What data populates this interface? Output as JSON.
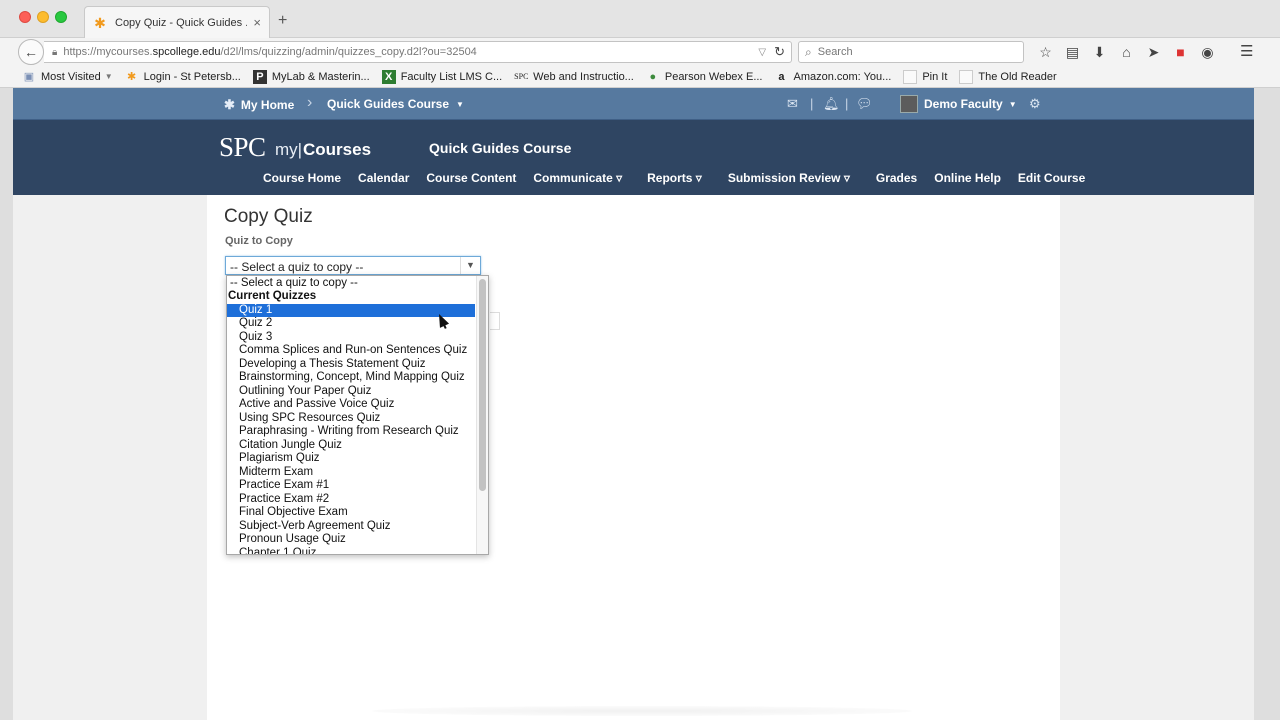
{
  "browser": {
    "tab_title": "Copy Quiz - Quick Guides ...",
    "tab_close": "×",
    "new_tab": "+",
    "url_prefix": "https://mycourses.",
    "url_domain": "spcollege.edu",
    "url_path": "/d2l/lms/quizzing/admin/quizzes_copy.d2l?ou=32504",
    "search_placeholder": "Search",
    "bookmarks": [
      {
        "label": "Most Visited",
        "icon": "folder-icon",
        "color": "#7a8fb5"
      },
      {
        "label": "Login - St Petersb...",
        "icon": "spc-icon",
        "color": "#f19a1e"
      },
      {
        "label": "MyLab & Masterin...",
        "icon": "pearson-p-icon",
        "color": "#333333"
      },
      {
        "label": "Faculty List LMS C...",
        "icon": "excel-icon",
        "color": "#2e7d32"
      },
      {
        "label": "Web and Instructio...",
        "icon": "spc-text-icon",
        "color": "#333333"
      },
      {
        "label": "Pearson Webex E...",
        "icon": "globe-icon",
        "color": "#3d8b3d"
      },
      {
        "label": "Amazon.com: You...",
        "icon": "amazon-icon",
        "color": "#111111"
      },
      {
        "label": "Pin It",
        "icon": "page-icon",
        "color": "#bbbbbb"
      },
      {
        "label": "The Old Reader",
        "icon": "page-icon",
        "color": "#bbbbbb"
      }
    ]
  },
  "minibar": {
    "home_label": "My Home",
    "course_label": "Quick Guides Course",
    "user_label": "Demo Faculty"
  },
  "navbar": {
    "logo_spc": "SPC",
    "logo_my": "my|",
    "logo_courses": "Courses",
    "course_title": "Quick Guides Course",
    "links": [
      "Course Home",
      "Calendar",
      "Course Content",
      "Communicate ▿",
      "Reports ▿",
      "Submission Review ▿",
      "Grades",
      "Online Help",
      "Edit Course"
    ]
  },
  "content": {
    "page_title": "Copy Quiz",
    "field_label": "Quiz to Copy",
    "select_value": "-- Select a quiz to copy --"
  },
  "dropdown": {
    "placeholder": "-- Select a quiz to copy --",
    "group_label": "Current Quizzes",
    "selected": "Quiz 1",
    "options": [
      "Quiz 1",
      "Quiz 2",
      "Quiz 3",
      "Comma Splices and Run-on Sentences Quiz",
      "Developing a Thesis Statement Quiz",
      "Brainstorming, Concept, Mind Mapping Quiz",
      "Outlining Your Paper Quiz",
      "Active and Passive Voice Quiz",
      "Using SPC Resources Quiz",
      "Paraphrasing - Writing from Research Quiz",
      "Citation Jungle Quiz",
      "Plagiarism Quiz",
      "Midterm Exam",
      "Practice Exam #1",
      "Practice Exam #2",
      "Final Objective Exam",
      "Subject-Verb Agreement Quiz",
      "Pronoun Usage Quiz",
      "Chapter 1 Quiz"
    ]
  },
  "colors": {
    "minibar": "#56799f",
    "navbar": "#2f4562",
    "selection": "#1e6fd9"
  }
}
